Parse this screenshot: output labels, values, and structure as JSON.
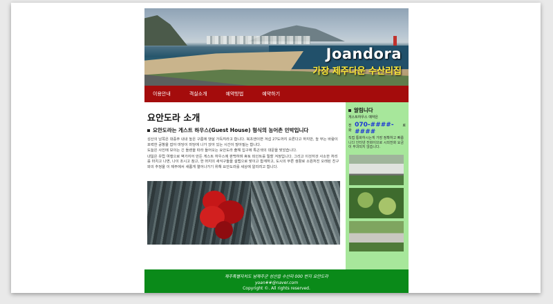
{
  "header": {
    "title": "Joandora",
    "subtitle": "가장 제주다운 수산리집"
  },
  "nav": {
    "items": [
      "이용안내",
      "객실소개",
      "예약방법",
      "예약하기"
    ]
  },
  "main": {
    "page_title": "요안도라 소개",
    "section_title": "요안도라는 게스트 하우스(Guest House) 형식의 농어촌 민박입니다",
    "paragraphs": [
      "성산의 남쪽은 대중주 내내 높은 구름에 뱃살 가득히라고 합니다. 북초엔이면 겨섭 27도까지 오른다고 하지만, 높 부는 바람이 포력한 공항을 잡아 마당이 마당에 나가 앉아 있는 시간이 많아질는 합니다.",
      "도늘은 사진에 보이는 긴 돌렌을 따라 들어오는 요안도라 출해 입구에 특곤색의 대문을 맞았습니다.",
      "내일은 유럽 여행으로 벽가지어 만든 게스트 하우스에 판백하며 휴토 피인트를 릴할 겨정입니다. 그리고 이것저것 사소한 처리를 마치고 나면, 나이 조시고 참고, 한 머지의 새식구들을 설랩으로 맞이고 합계하고, 도시의 부른 생활로 소원처진 오래된 친구와의 추정을 이 제주에서 새롭게 열어나가기 위해 요안도라를 세상에 알리려고 합니다."
    ]
  },
  "sidebar": {
    "title": "알림니다",
    "line1": "게스트하우스 예약은",
    "phone_prefix": "전화",
    "phone": "070-####-####",
    "phone_suffix": "로",
    "desc": "직접 통화하시는게 가장 정확하고 빠릅니다 인터넷 전화이므로 시외전화 요금이 부과되지 않습니다."
  },
  "footer": {
    "address": "제주특별자치도 남제주군 성산읍 수산리 000 번지 요안도라",
    "email": "yoan##@naver.com",
    "copyright": "Copyright ©. All rights reserved."
  },
  "colors": {
    "nav_bg": "#a40c0c",
    "sidebar_bg": "#a7e79b",
    "footer_bg": "#0a8a19",
    "phone": "#1a35d6",
    "title_yellow": "#ffec3a"
  }
}
